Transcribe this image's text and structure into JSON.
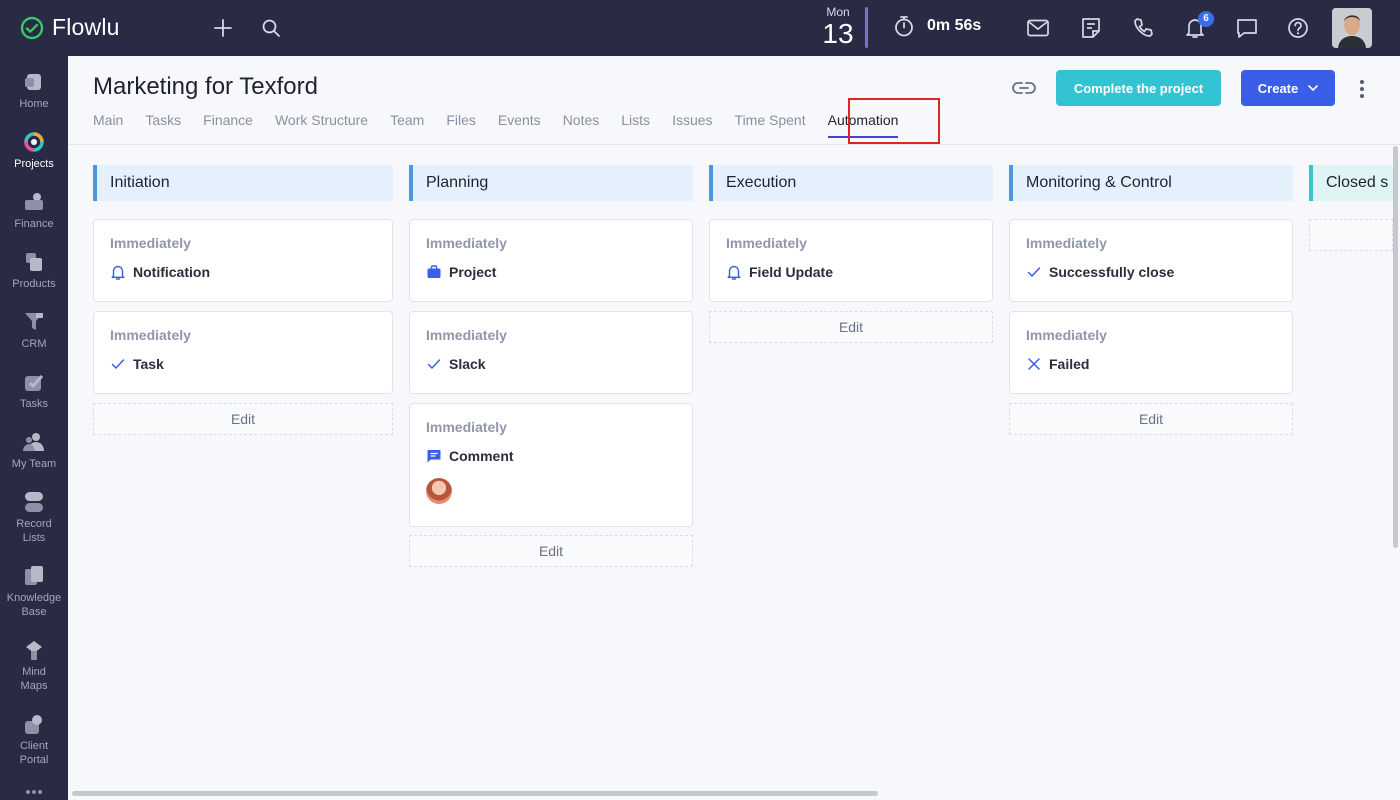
{
  "app": {
    "name": "Flowlu"
  },
  "topbar": {
    "date_day": "Mon",
    "date_num": "13",
    "timer": "0m 56s",
    "notifications_count": "6",
    "icons": [
      "plus-icon",
      "search-icon",
      "stopwatch-icon",
      "mail-icon",
      "notes-icon",
      "phone-icon",
      "bell-icon",
      "chat-icon",
      "help-icon"
    ]
  },
  "sidebar": {
    "items": [
      {
        "label": "Home",
        "icon": "home-icon"
      },
      {
        "label": "Projects",
        "icon": "projects-icon",
        "active": true
      },
      {
        "label": "Finance",
        "icon": "finance-icon"
      },
      {
        "label": "Products",
        "icon": "products-icon"
      },
      {
        "label": "CRM",
        "icon": "crm-icon"
      },
      {
        "label": "Tasks",
        "icon": "tasks-icon"
      },
      {
        "label": "My Team",
        "icon": "team-icon"
      },
      {
        "label": "Record Lists",
        "icon": "record-lists-icon"
      },
      {
        "label": "Knowledge Base",
        "icon": "knowledge-base-icon"
      },
      {
        "label": "Mind Maps",
        "icon": "mind-maps-icon"
      },
      {
        "label": "Client Portal",
        "icon": "client-portal-icon"
      }
    ]
  },
  "header": {
    "title": "Marketing for Texford",
    "tabs": [
      "Main",
      "Tasks",
      "Finance",
      "Work Structure",
      "Team",
      "Files",
      "Events",
      "Notes",
      "Lists",
      "Issues",
      "Time Spent",
      "Automation"
    ],
    "active_tab": "Automation",
    "complete_label": "Complete the project",
    "create_label": "Create"
  },
  "colors": {
    "accent": "#3b5ee8",
    "complete": "#34c3d3",
    "header_bg": "#282b43",
    "stage_border": "#4a98e4"
  },
  "board": {
    "edit_label": "Edit",
    "columns": [
      {
        "title": "Initiation",
        "cards": [
          {
            "timing": "Immediately",
            "action": "Notification",
            "icon": "bell-icon"
          },
          {
            "timing": "Immediately",
            "action": "Task",
            "icon": "check-icon"
          }
        ]
      },
      {
        "title": "Planning",
        "cards": [
          {
            "timing": "Immediately",
            "action": "Project",
            "icon": "briefcase-icon"
          },
          {
            "timing": "Immediately",
            "action": "Slack",
            "icon": "check-icon"
          },
          {
            "timing": "Immediately",
            "action": "Comment",
            "icon": "comment-icon"
          }
        ]
      },
      {
        "title": "Execution",
        "cards": [
          {
            "timing": "Immediately",
            "action": "Field Update",
            "icon": "bell-icon"
          }
        ]
      },
      {
        "title": "Monitoring & Control",
        "cards": [
          {
            "timing": "Immediately",
            "action": "Successfully close",
            "icon": "check-icon"
          },
          {
            "timing": "Immediately",
            "action": "Failed",
            "icon": "x-icon"
          }
        ]
      },
      {
        "title": "Closed s",
        "cards": []
      }
    ]
  }
}
